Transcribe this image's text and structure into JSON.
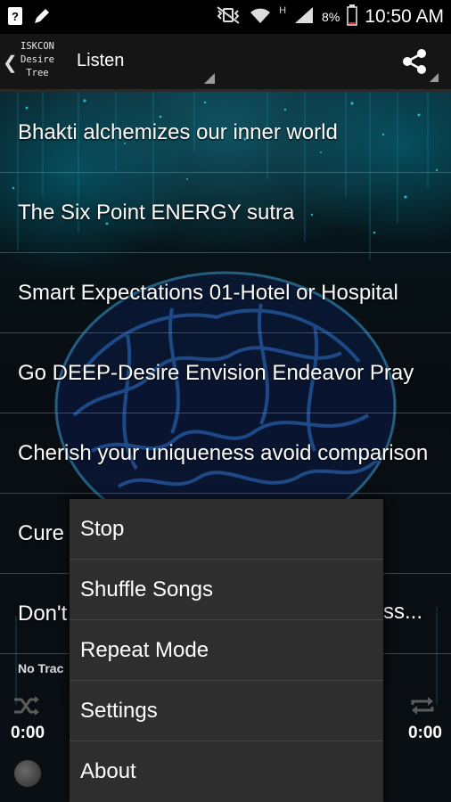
{
  "status_bar": {
    "battery": "8%",
    "network_type": "H",
    "time": "10:50 AM",
    "icons": [
      "unknown-app-icon",
      "pencil-icon",
      "vibrate-mute-icon",
      "wifi-icon",
      "signal-icon",
      "battery-icon"
    ]
  },
  "action_bar": {
    "logo_lines": [
      "ISKCON",
      "Desire",
      "Tree"
    ],
    "title": "Listen",
    "share_icon": "share-icon"
  },
  "tracks": [
    "Bhakti alchemizes our inner world",
    "The Six Point ENERGY sutra",
    "Smart Expectations 01-Hotel or Hospital",
    "Go DEEP-Desire Envision Endeavor Pray",
    "Cherish your uniqueness avoid comparison",
    "Cure",
    "Don't"
  ],
  "track_suffix_visible": "ss...",
  "player": {
    "status": "No Trac",
    "time_elapsed": "0:00",
    "time_total": "0:00",
    "colors": {
      "icon": "#5b5b5b"
    }
  },
  "menu": {
    "items": [
      "Stop",
      "Shuffle Songs",
      "Repeat Mode",
      "Settings",
      "About"
    ]
  },
  "colors": {
    "status_bar_bg": "#000000",
    "action_bar_bg": "#151515",
    "menu_bg": "#2e2e2e",
    "accent_glow": "#19a7c4"
  }
}
